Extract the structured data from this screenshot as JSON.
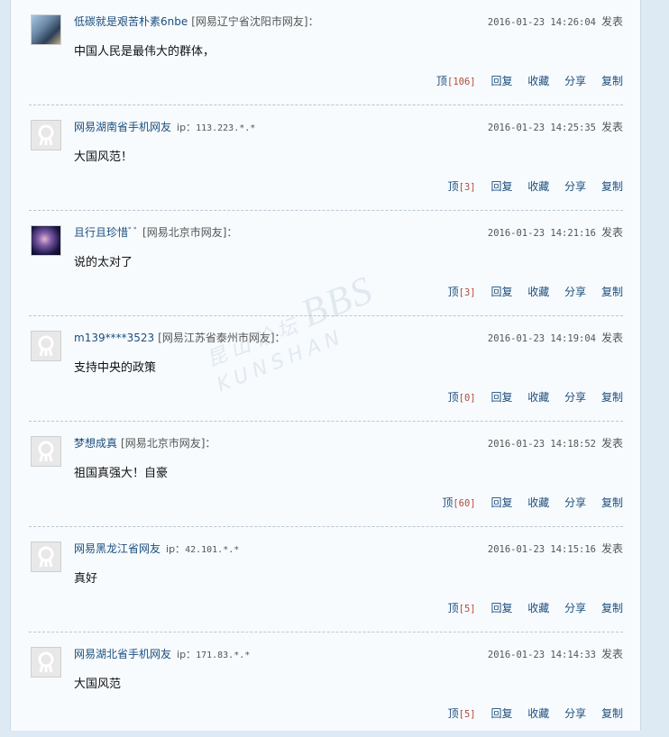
{
  "labels": {
    "post_suffix": "发表",
    "reply": "回复",
    "favorite": "收藏",
    "share": "分享",
    "copy": "复制",
    "upvote": "顶",
    "ip_prefix": "ip："
  },
  "watermark": {
    "chinese": "昆山论坛",
    "big": "BBS",
    "latin": "KUNSHAN"
  },
  "comments": [
    {
      "user": "低碳就是艰苦朴素6nbe",
      "location": "[网易辽宁省沈阳市网友]：",
      "ip": "",
      "time": "2016-01-23 14:26:04",
      "text": "中国人民是最伟大的群体，",
      "votes": "[106]",
      "avatar": "photo-avatar"
    },
    {
      "user": "网易湖南省手机网友",
      "location": "",
      "ip": "113.223.*.*",
      "time": "2016-01-23 14:25:35",
      "text": "大国风范！",
      "votes": "[3]",
      "avatar": "default-avatar"
    },
    {
      "user": "且行且珍惜ﾞﾞ",
      "location": "[网易北京市网友]：",
      "ip": "",
      "time": "2016-01-23 14:21:16",
      "text": "说的太对了",
      "votes": "[3]",
      "avatar": "photo-avatar"
    },
    {
      "user": "m139****3523",
      "location": "[网易江苏省泰州市网友]：",
      "ip": "",
      "time": "2016-01-23 14:19:04",
      "text": "支持中央的政策",
      "votes": "[0]",
      "avatar": "default-avatar"
    },
    {
      "user": "梦想成真",
      "location": "[网易北京市网友]：",
      "ip": "",
      "time": "2016-01-23 14:18:52",
      "text": "祖国真强大！自豪",
      "votes": "[60]",
      "avatar": "default-avatar"
    },
    {
      "user": "网易黑龙江省网友",
      "location": "",
      "ip": "42.101.*.*",
      "time": "2016-01-23 14:15:16",
      "text": "真好",
      "votes": "[5]",
      "avatar": "default-avatar"
    },
    {
      "user": "网易湖北省手机网友",
      "location": "",
      "ip": "171.83.*.*",
      "time": "2016-01-23 14:14:33",
      "text": "大国风范",
      "votes": "[5]",
      "avatar": "default-avatar"
    }
  ]
}
